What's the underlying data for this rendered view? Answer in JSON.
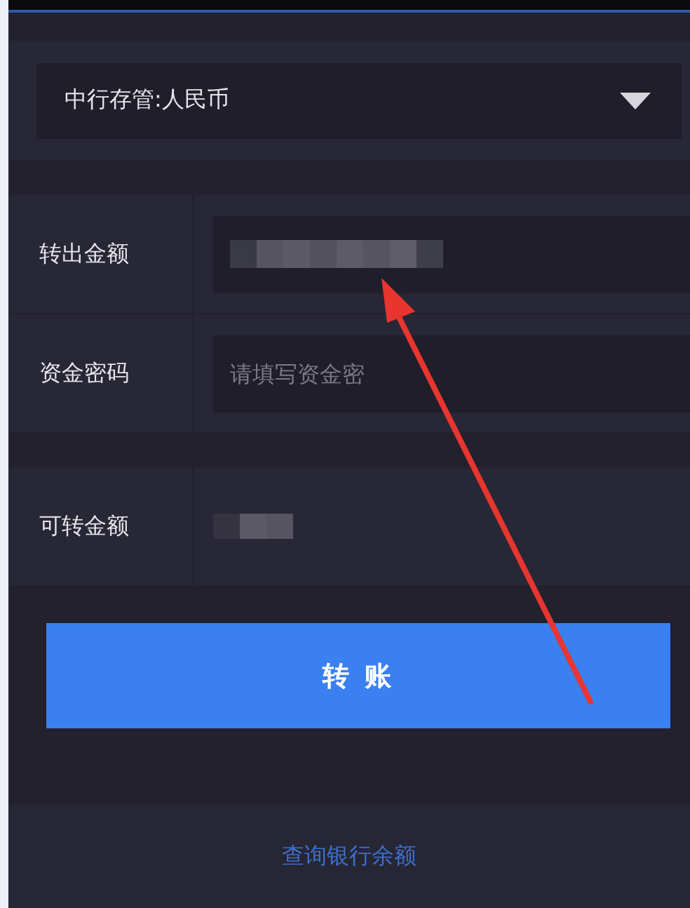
{
  "account_select": {
    "value": "中行存管:人民币"
  },
  "form": {
    "rows": [
      {
        "kind": "input",
        "label": "转出金额",
        "redacted": true
      },
      {
        "kind": "input",
        "label": "资金密码",
        "placeholder": "请填写资金密"
      }
    ]
  },
  "available": {
    "label": "可转金额",
    "redacted": true
  },
  "submit_button": {
    "label": "转 账"
  },
  "footer_link": {
    "label": "查询银行余额"
  }
}
